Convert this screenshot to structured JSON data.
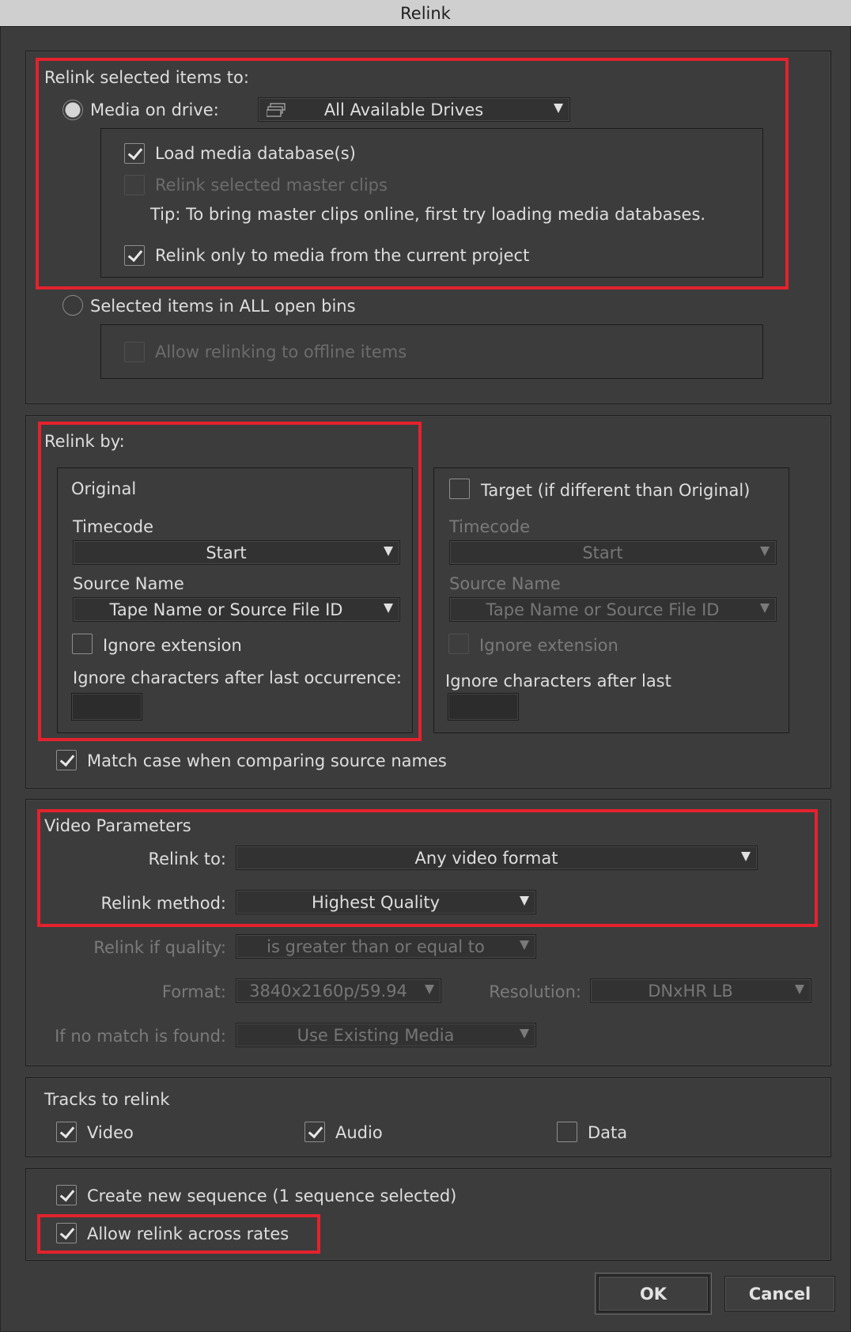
{
  "window": {
    "title": "Relink"
  },
  "relink_to": {
    "heading": "Relink selected items to:",
    "media_on_drive_label": "Media on drive:",
    "drive_dropdown_value": "All Available Drives",
    "load_media_db_label": "Load media database(s)",
    "relink_master_clips_label": "Relink selected master clips",
    "tip": "Tip: To bring master clips online, first try loading media databases.",
    "relink_current_project_label": "Relink only to media from the current project",
    "selected_items_label": "Selected items in ALL open bins",
    "allow_offline_label": "Allow relinking to offline items"
  },
  "relink_by": {
    "heading": "Relink by:",
    "original": {
      "title": "Original",
      "timecode_label": "Timecode",
      "timecode_value": "Start",
      "source_name_label": "Source Name",
      "source_name_value": "Tape Name or Source File ID",
      "ignore_extension_label": "Ignore extension",
      "ignore_chars_label": "Ignore characters after last occurrence:"
    },
    "target": {
      "title": "Target (if different than Original)",
      "timecode_label": "Timecode",
      "timecode_value": "Start",
      "source_name_label": "Source Name",
      "source_name_value": "Tape Name or Source File ID",
      "ignore_extension_label": "Ignore extension",
      "ignore_chars_label": "Ignore characters after last"
    },
    "match_case_label": "Match case when comparing source names"
  },
  "video_parameters": {
    "heading": "Video Parameters",
    "relink_to_label": "Relink to:",
    "relink_to_value": "Any video format",
    "relink_method_label": "Relink method:",
    "relink_method_value": "Highest Quality",
    "relink_if_quality_label": "Relink if quality:",
    "relink_if_quality_value": "is greater than or equal to",
    "format_label": "Format:",
    "format_value": "3840x2160p/59.94",
    "resolution_label": "Resolution:",
    "resolution_value": "DNxHR LB",
    "no_match_label": "If no match is found:",
    "no_match_value": "Use Existing Media"
  },
  "tracks": {
    "heading": "Tracks to relink",
    "video_label": "Video",
    "audio_label": "Audio",
    "data_label": "Data"
  },
  "options": {
    "create_sequence_label": "Create new sequence  (1 sequence selected)",
    "allow_relink_rates_label": "Allow relink across rates"
  },
  "buttons": {
    "ok": "OK",
    "cancel": "Cancel"
  },
  "colors": {
    "highlight": "#e3222d",
    "background": "#3c3c3c",
    "titlebar": "#cfcfcf"
  }
}
